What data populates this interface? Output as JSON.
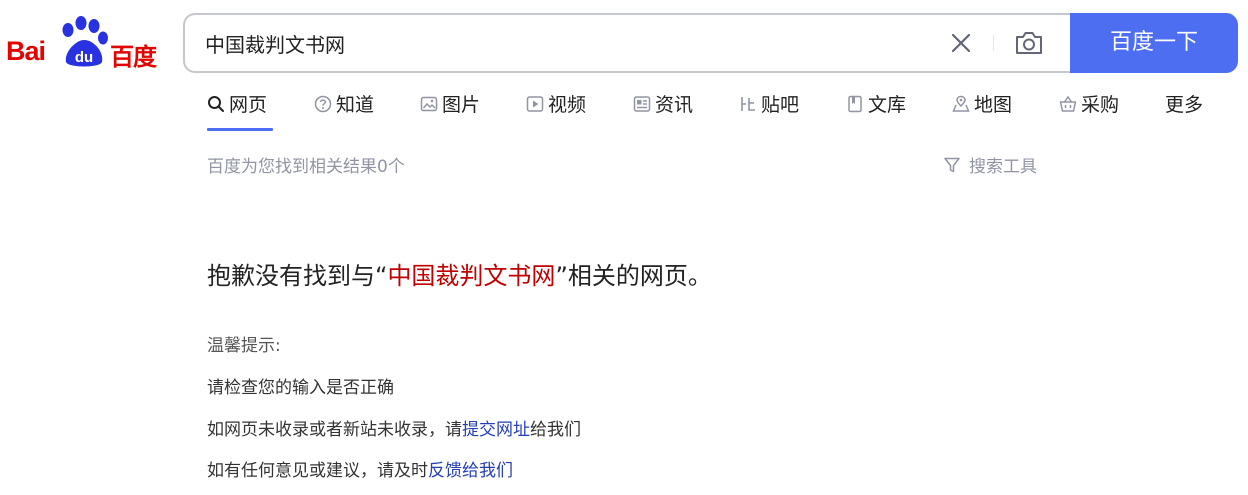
{
  "logo": {
    "text_en": "Bai",
    "text_du": "du",
    "text_cn": "百度",
    "color": "#e10602",
    "paw_color": "#2932e1"
  },
  "search": {
    "query": "中国裁判文书网",
    "button_label": "百度一下",
    "button_color": "#4e6ef2"
  },
  "tabs": [
    {
      "label": "网页",
      "icon": "search-icon",
      "active": true
    },
    {
      "label": "知道",
      "icon": "question-icon"
    },
    {
      "label": "图片",
      "icon": "image-icon"
    },
    {
      "label": "视频",
      "icon": "play-icon"
    },
    {
      "label": "资讯",
      "icon": "news-icon"
    },
    {
      "label": "贴吧",
      "icon": "tieba-icon"
    },
    {
      "label": "文库",
      "icon": "document-icon"
    },
    {
      "label": "地图",
      "icon": "map-icon"
    },
    {
      "label": "采购",
      "icon": "basket-icon"
    },
    {
      "label": "更多"
    }
  ],
  "result": {
    "count_text": "百度为您找到相关结果0个",
    "tools_label": "搜索工具"
  },
  "message": {
    "prefix": "抱歉没有找到与“",
    "query": "中国裁判文书网",
    "suffix": "”相关的网页。"
  },
  "tips": {
    "title": "温馨提示:",
    "line1": "请检查您的输入是否正确",
    "line2_prefix": "如网页未收录或者新站未收录，请",
    "line2_link": "提交网址",
    "line2_suffix": "给我们",
    "line3_prefix": "如有任何意见或建议，请及时",
    "line3_link": "反馈给我们"
  }
}
